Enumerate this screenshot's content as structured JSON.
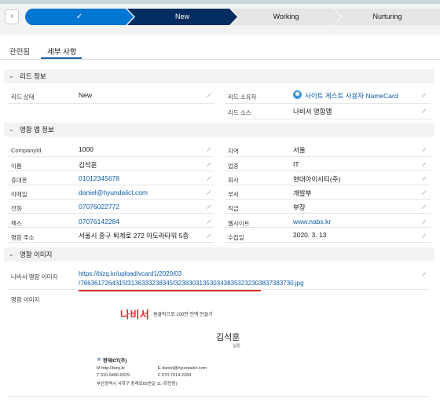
{
  "path": {
    "stages": [
      {
        "label": "✓",
        "status": "complete"
      },
      {
        "label": "New",
        "status": "current"
      },
      {
        "label": "Working",
        "status": "upcoming"
      },
      {
        "label": "Nurturing",
        "status": "upcoming"
      }
    ],
    "toggle_icon": "chevron-right-icon",
    "colors": {
      "complete": "#0176d3",
      "current": "#032d60",
      "upcoming": "#e5e5e5"
    }
  },
  "tabs": [
    {
      "label": "관련됨",
      "active": false
    },
    {
      "label": "세부 사항",
      "active": true
    }
  ],
  "sections": {
    "lead_info": {
      "title": "리드 정보",
      "left": [
        {
          "label": "리드 상태",
          "value": "New"
        }
      ],
      "right": [
        {
          "label": "리드 소유자",
          "value": "사이트 게스트 사용자 NameCard"
        },
        {
          "label": "리드 소스",
          "value": "나비서 명함앱"
        }
      ]
    },
    "card_app_info": {
      "title": "명함 앱 정보",
      "left": [
        {
          "label": "CompanyId",
          "value": "1000"
        },
        {
          "label": "이름",
          "value": "김석훈"
        },
        {
          "label": "휴대폰",
          "value": "01012345678"
        },
        {
          "label": "이메일",
          "value": "daniel@hyundaiict.com"
        },
        {
          "label": "전화",
          "value": "07076022772"
        },
        {
          "label": "팩스",
          "value": "07076142284"
        },
        {
          "label": "명함 주소",
          "value": "서울시 중구 퇴계로 272 아도라타워 5층"
        }
      ],
      "right": [
        {
          "label": "지역",
          "value": "서울"
        },
        {
          "label": "업종",
          "value": "IT"
        },
        {
          "label": "회사",
          "value": "현대아이시티(주)"
        },
        {
          "label": "부서",
          "value": "개발부"
        },
        {
          "label": "직급",
          "value": "부장"
        },
        {
          "label": "웹사이트",
          "value": "www.nabs.kr"
        },
        {
          "label": "수집일",
          "value": "2020. 3. 13"
        }
      ]
    },
    "card_image": {
      "title": "명함 이미지",
      "url_label": "나비서 명함 이미지",
      "url_lines": [
        "https://bizq.kr/upload/vcard1/2020/03",
        "/7663617264315f3136333238345f3238303135303438353232303837383730.jpg"
      ],
      "image_label": "명함 이미지"
    }
  },
  "business_card": {
    "brand": "나비서",
    "tagline": "원클릭으로 100만 인맥 만들기",
    "name": "김석훈",
    "title": "실장",
    "company_mark": "✕",
    "company": "현대ICT(주)",
    "line1_left": "M  http://bizq.kr",
    "line1_right": "E  daniel@hyundaiict.com",
    "line2_left": "T  010-9490-8329",
    "line2_right": "F  070-7614-2284",
    "address": "부산광역시 사하구 동래로65번길 11 (하단동)"
  }
}
